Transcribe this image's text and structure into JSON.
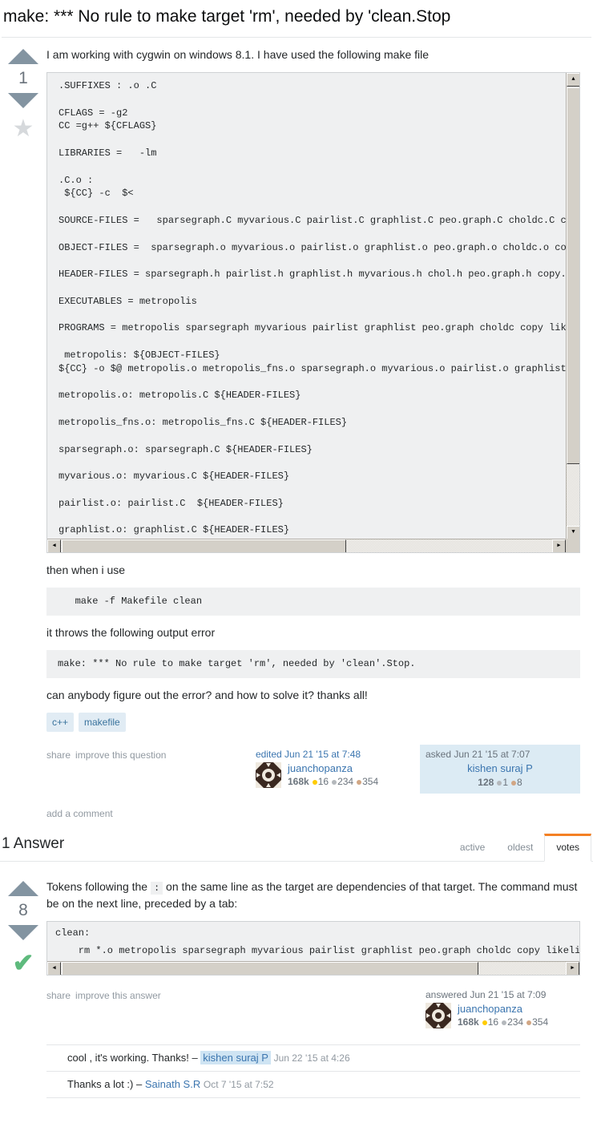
{
  "question": {
    "title": "make: *** No rule to make target 'rm', needed by 'clean.Stop",
    "vote_count": "1",
    "star_icon": "★",
    "intro": "I am working with cygwin on windows 8.1. I have used the following make file",
    "makefile_lines": [
      ".SUFFIXES : .o .C",
      "",
      "CFLAGS = -g2",
      "CC =g++ ${CFLAGS}",
      "",
      "LIBRARIES =   -lm",
      "",
      ".C.o :",
      " ${CC} -c  $<",
      "",
      "SOURCE-FILES =   sparsegraph.C myvarious.C pairlist.C graphlist.C peo.graph.C choldc.C copy.C likelihood.C",
      "",
      "OBJECT-FILES =  sparsegraph.o myvarious.o pairlist.o graphlist.o peo.graph.o choldc.o copy.o likelihood.o",
      "",
      "HEADER-FILES = sparsegraph.h pairlist.h graphlist.h myvarious.h chol.h peo.graph.h copy.h",
      "",
      "EXECUTABLES = metropolis",
      "",
      "PROGRAMS = metropolis sparsegraph myvarious pairlist graphlist peo.graph choldc copy likelihood",
      "",
      " metropolis: ${OBJECT-FILES}",
      "${CC} -o $@ metropolis.o metropolis_fns.o sparsegraph.o myvarious.o pairlist.o graphlist.o peo.graph.o",
      "",
      "metropolis.o: metropolis.C ${HEADER-FILES}",
      "",
      "metropolis_fns.o: metropolis_fns.C ${HEADER-FILES}",
      "",
      "sparsegraph.o: sparsegraph.C ${HEADER-FILES}",
      "",
      "myvarious.o: myvarious.C ${HEADER-FILES}",
      "",
      "pairlist.o: pairlist.C  ${HEADER-FILES}",
      "",
      "graphlist.o: graphlist.C ${HEADER-FILES}"
    ],
    "then_text": "then when i use",
    "command_code": "   make -f Makefile clean",
    "error_text": "it throws the following output error",
    "error_code": "make: *** No rule to make target 'rm', needed by 'clean'.Stop.",
    "closing_text": "can anybody figure out the error? and how to solve it? thanks all!",
    "tags": [
      "c++",
      "makefile"
    ],
    "menu": {
      "share": "share",
      "improve": "improve this question"
    },
    "add_comment": "add a comment",
    "editor": {
      "action": "edited Jun 21 '15 at 7:48",
      "name": "juanchopanza",
      "rep": "168k",
      "gold": "16",
      "silver": "234",
      "bronze": "354"
    },
    "owner": {
      "action": "asked Jun 21 '15 at 7:07",
      "name": "kishen suraj P",
      "rep": "128",
      "silver": "1",
      "bronze": "8"
    }
  },
  "answers_section": {
    "heading": "1 Answer",
    "tabs": [
      {
        "label": "active",
        "selected": false
      },
      {
        "label": "oldest",
        "selected": false
      },
      {
        "label": "votes",
        "selected": true
      }
    ]
  },
  "answer": {
    "vote_count": "8",
    "accepted_icon": "✔",
    "body_part1": "Tokens following the ",
    "body_inline_code": ":",
    "body_part2": " on the same line as the target are dependencies of that target. The command must be on the next line, preceded by a tab:",
    "code_lines": [
      "clean:",
      "    rm *.o metropolis sparsegraph myvarious pairlist graphlist peo.graph choldc copy likelihood"
    ],
    "menu": {
      "share": "share",
      "improve": "improve this answer"
    },
    "owner": {
      "action": "answered Jun 21 '15 at 7:09",
      "name": "juanchopanza",
      "rep": "168k",
      "gold": "16",
      "silver": "234",
      "bronze": "354"
    },
    "comments": [
      {
        "text": "cool , it's working. Thanks!",
        "dash": "–",
        "user": "kishen suraj P",
        "highlight": true,
        "date": "Jun 22 '15 at 4:26"
      },
      {
        "text": "Thanks a lot :)",
        "dash": "–",
        "user": "Sainath S.R",
        "highlight": false,
        "date": "Oct 7 '15 at 7:52"
      }
    ]
  },
  "scrollbar": {
    "up_arrow": "▲",
    "down_arrow": "▼",
    "left_arrow": "◀",
    "right_arrow": "▶"
  },
  "colors": {
    "accent": "#f48024",
    "link": "#3b75af",
    "tag_bg": "#e1ecf4",
    "tag_fg": "#39739d",
    "owner_card_bg": "#dcebf4",
    "code_bg": "#eff0f1",
    "accepted_green": "#5eba7d"
  }
}
